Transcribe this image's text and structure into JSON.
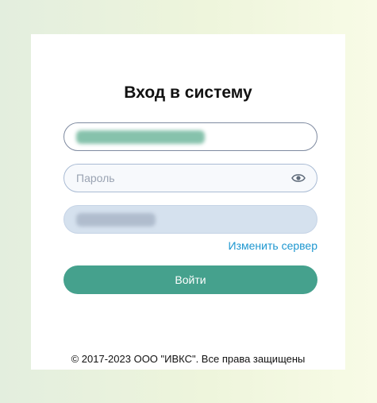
{
  "form": {
    "title": "Вход в систему",
    "password_placeholder": "Пароль",
    "change_server_label": "Изменить сервер",
    "submit_label": "Войти"
  },
  "footer": {
    "copyright": "© 2017-2023 ООО \"ИВКС\". Все права защищены"
  },
  "icons": {
    "password_toggle": "eye-icon"
  },
  "colors": {
    "accent": "#45a18d",
    "link": "#1e97d0"
  }
}
